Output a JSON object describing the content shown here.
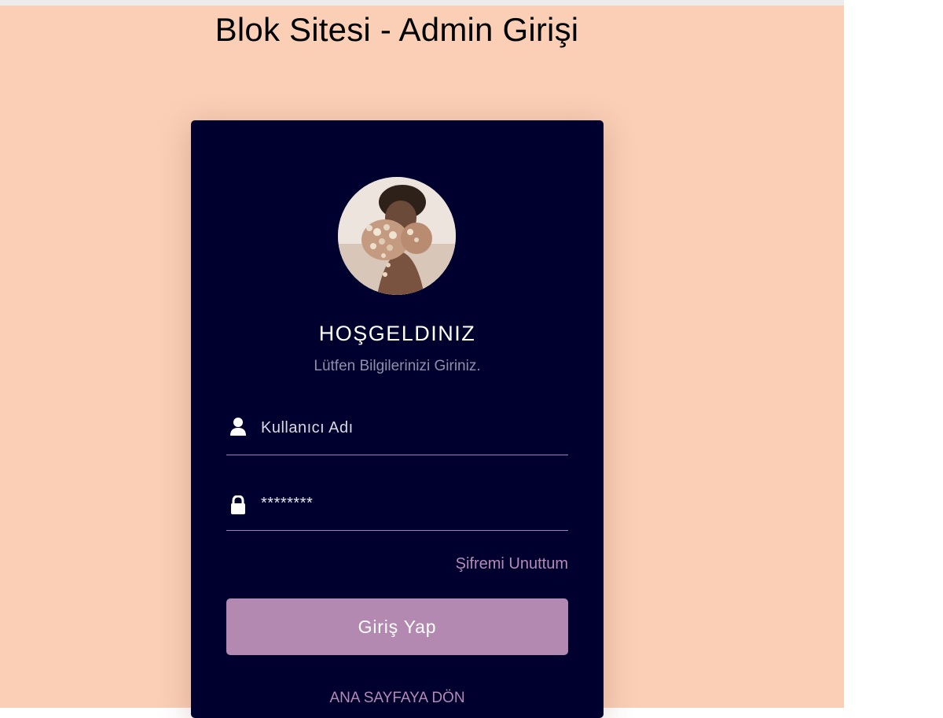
{
  "page": {
    "title": "Blok Sitesi - Admin Girişi",
    "background_color": "#facfb6"
  },
  "card": {
    "background_color": "#00002f",
    "avatar_icon": "profile-photo",
    "welcome": "HOŞGELDINIZ",
    "subtitle": "Lütfen Bilgilerinizi Giriniz.",
    "username": {
      "icon": "user-icon",
      "placeholder": "Kullanıcı Adı",
      "value": ""
    },
    "password": {
      "icon": "lock-icon",
      "value": "********"
    },
    "forgot_password": "Şifremi Unuttum",
    "login_button": "Giriş Yap",
    "home_link": "ANA SAYFAYA DÖN",
    "accent_color": "#b489b1"
  }
}
